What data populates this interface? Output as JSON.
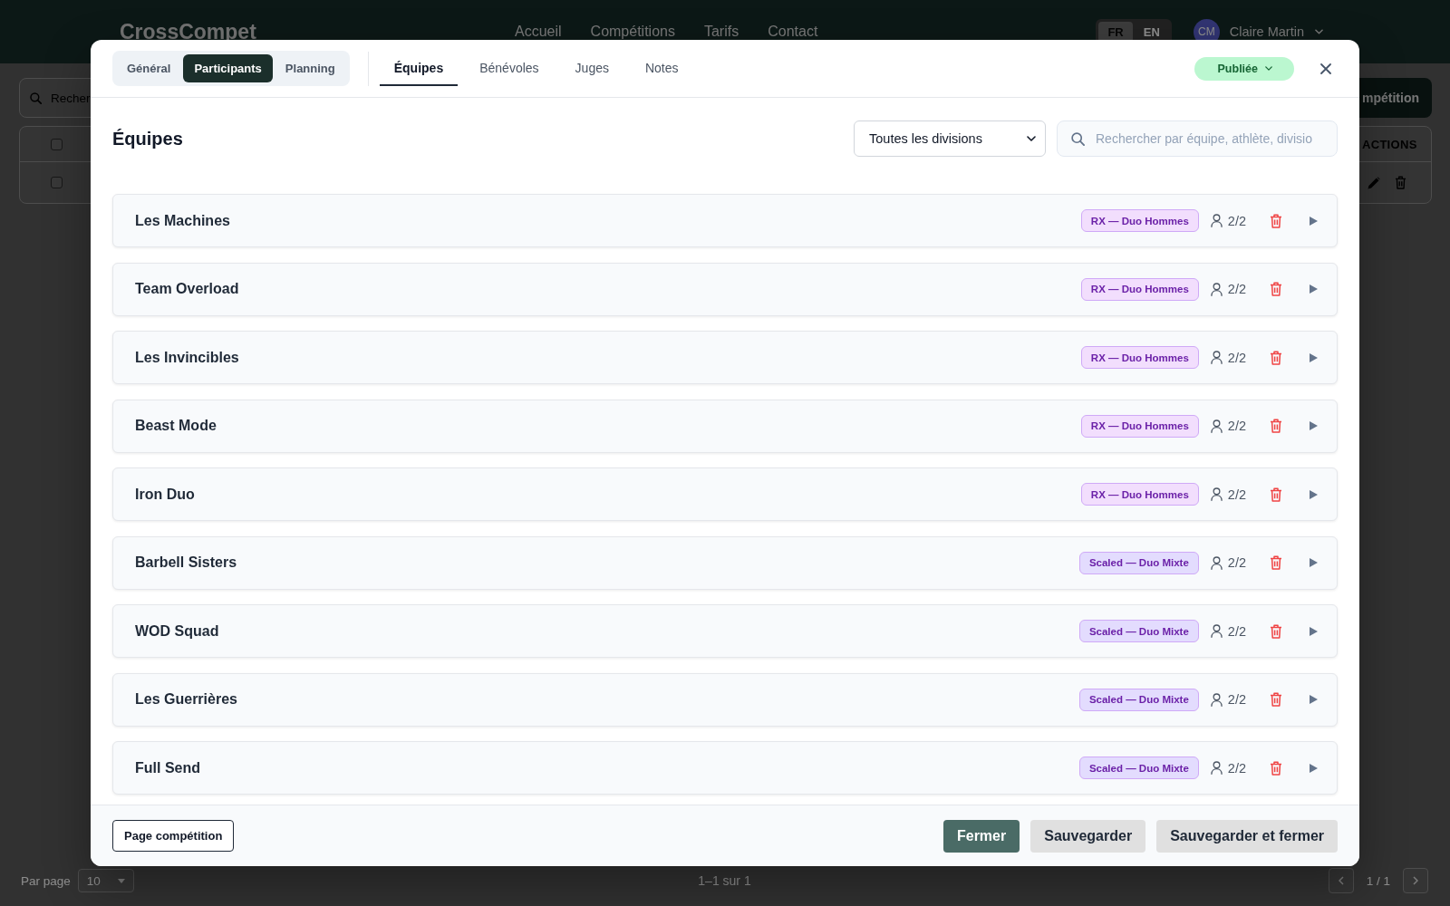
{
  "background": {
    "header": {
      "logo": "CrossCompet",
      "nav": [
        "Accueil",
        "Compétitions",
        "Tarifs",
        "Contact"
      ],
      "languages": [
        {
          "label": "FR",
          "selected": true
        },
        {
          "label": "EN",
          "selected": false
        }
      ],
      "user": {
        "initials": "CM",
        "name": "Claire Martin"
      }
    },
    "search": {
      "placeholder": "Recher"
    },
    "create_button": {
      "label": "mpétition"
    },
    "table": {
      "header": {
        "checked": false,
        "actions_label": "ACTIONS"
      },
      "rows": [
        {
          "checked": false
        }
      ]
    },
    "pagination": {
      "per_page_label": "Par page",
      "per_page": "10",
      "range": "1–1 sur 1",
      "page": "1 / 1"
    }
  },
  "modal": {
    "sections": [
      {
        "label": "Général",
        "selected": false
      },
      {
        "label": "Participants",
        "selected": true
      },
      {
        "label": "Planning",
        "selected": false
      }
    ],
    "tabs": [
      {
        "label": "Équipes",
        "selected": true
      },
      {
        "label": "Bénévoles",
        "selected": false
      },
      {
        "label": "Juges",
        "selected": false
      },
      {
        "label": "Notes",
        "selected": false
      }
    ],
    "status": {
      "label": "Publiée"
    },
    "title": "Équipes",
    "division_filter": {
      "value": "Toutes les divisions"
    },
    "search": {
      "placeholder": "Rechercher par équipe, athlète, divisio"
    },
    "teams": [
      {
        "name": "Les Machines",
        "division": "RX — Duo Hommes",
        "color": "#f2defd",
        "members": "2/2",
        "expanded": false
      },
      {
        "name": "Team Overload",
        "division": "RX — Duo Hommes",
        "color": "#f2defd",
        "members": "2/2",
        "expanded": false
      },
      {
        "name": "Les Invincibles",
        "division": "RX — Duo Hommes",
        "color": "#f2defd",
        "members": "2/2",
        "expanded": false
      },
      {
        "name": "Beast Mode",
        "division": "RX — Duo Hommes",
        "color": "#f2defd",
        "members": "2/2",
        "expanded": false
      },
      {
        "name": "Iron Duo",
        "division": "RX — Duo Hommes",
        "color": "#f2defd",
        "members": "2/2",
        "expanded": false
      },
      {
        "name": "Barbell Sisters",
        "division": "Scaled — Duo Mixte",
        "color": "#e3dcfe",
        "members": "2/2",
        "expanded": false
      },
      {
        "name": "WOD Squad",
        "division": "Scaled — Duo Mixte",
        "color": "#e3dcfe",
        "members": "2/2",
        "expanded": false
      },
      {
        "name": "Les Guerrières",
        "division": "Scaled — Duo Mixte",
        "color": "#e3dcfe",
        "members": "2/2",
        "expanded": false
      },
      {
        "name": "Full Send",
        "division": "Scaled — Duo Mixte",
        "color": "#e3dcfe",
        "members": "2/2",
        "expanded": false
      }
    ],
    "footer": {
      "left_button": "Page compétition",
      "buttons": [
        {
          "label": "Fermer",
          "kind": "primary"
        },
        {
          "label": "Sauvegarder",
          "kind": "secondary"
        },
        {
          "label": "Sauvegarder et fermer",
          "kind": "secondary"
        }
      ]
    }
  }
}
